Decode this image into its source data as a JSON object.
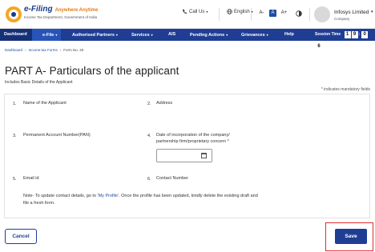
{
  "header": {
    "brand_title": "e-Filing",
    "brand_title_hindi": "Anywhere Anytime",
    "brand_subtitle": "Income Tax Department, Government of India",
    "call_label": "Call Us",
    "language_label": "English",
    "font_decrease": "A-",
    "font_normal": "A",
    "font_increase": "A+",
    "user_name": "Infosys Limited",
    "user_role": "Company"
  },
  "nav": {
    "items": [
      {
        "label": "Dashboard"
      },
      {
        "label": "e-File"
      },
      {
        "label": "Authorised Partners"
      },
      {
        "label": "Services"
      },
      {
        "label": "AIS"
      },
      {
        "label": "Pending Actions"
      },
      {
        "label": "Grievances"
      },
      {
        "label": "Help"
      }
    ],
    "session_label": "Session Time",
    "session_digits": [
      "1",
      "9",
      "0",
      "6"
    ]
  },
  "breadcrumb": {
    "items": [
      "Dashboard",
      "Income-tax Forms",
      "Form No. 20"
    ]
  },
  "page": {
    "title": "PART A- Particulars of the applicant",
    "subtitle": "Includes Basic Details of the Applicant",
    "mandatory_note": "* indicates mandatory fields"
  },
  "form": {
    "f1_num": "1.",
    "f1_label": "Name of the Applicant",
    "f2_num": "2.",
    "f2_label": "Address",
    "f3_num": "3.",
    "f3_label": "Permanent Account Number(PAN)",
    "f4_num": "4.",
    "f4_label_line1": "Date of incorporation of the company/",
    "f4_label_line2": "partnership firm/proprietary concern *",
    "f5_num": "5.",
    "f5_label": "Email id",
    "f6_num": "6.",
    "f6_label": "Contact Number",
    "note_pre": "Note- To update contact details, go to '",
    "note_link": "My Profile",
    "note_post": "'. Once the profile has been updated, kindly delete the existing draft and file a fresh form."
  },
  "actions": {
    "cancel_label": "Cancel",
    "save_label": "Save"
  },
  "colors": {
    "nav_bg": "#1f3e93",
    "save_highlight": "#e12c2c"
  }
}
